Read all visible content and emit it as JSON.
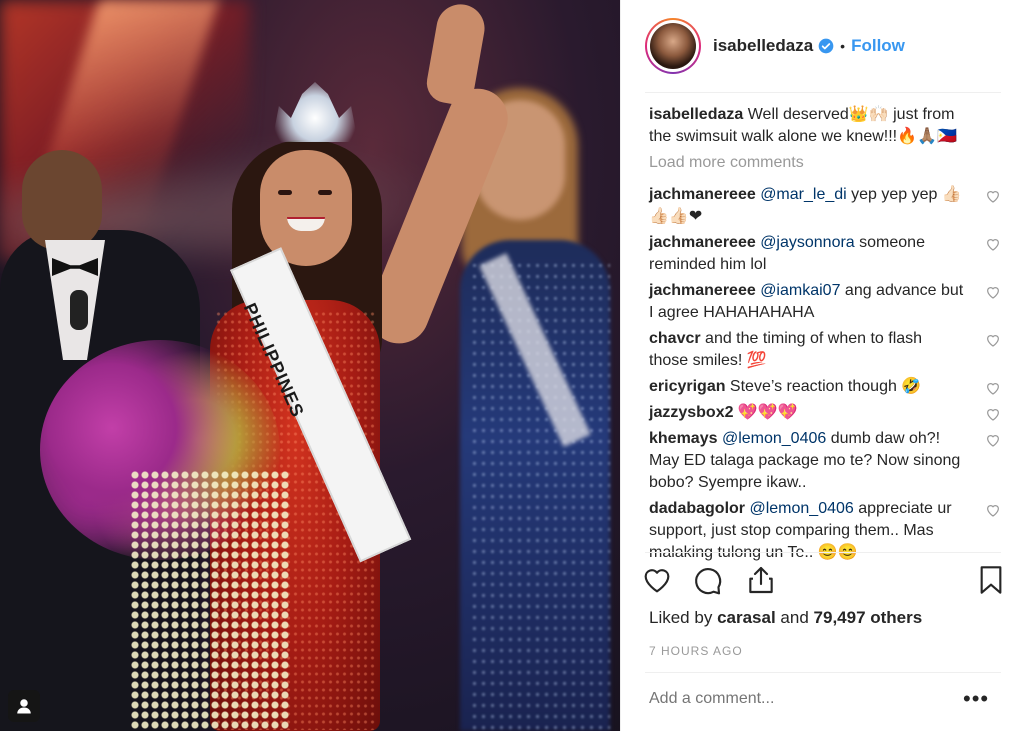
{
  "post": {
    "photo_alt": "Miss Universe winner waving",
    "sash_text": "PHILIPPINES"
  },
  "header": {
    "username": "isabelledaza",
    "dot": "•",
    "follow_label": "Follow"
  },
  "caption": {
    "username": "isabelledaza",
    "text": "Well deserved👑🙌🏻 just from the swimsuit walk alone we knew!!!🔥🙏🏽🇵🇭"
  },
  "load_more_label": "Load more comments",
  "comments": [
    {
      "username": "jachmanereee",
      "mention": "@mar_le_di",
      "text": " yep yep yep 👍🏻👍🏻👍🏻❤"
    },
    {
      "username": "jachmanereee",
      "mention": "@jaysonnora",
      "text": " someone reminded him lol"
    },
    {
      "username": "jachmanereee",
      "mention": "@iamkai07",
      "text": " ang advance but I agree HAHAHAHAHA"
    },
    {
      "username": "chavcr",
      "mention": "",
      "text": " and the timing of when to flash those smiles! 💯"
    },
    {
      "username": "ericyrigan",
      "mention": "",
      "text": " Steve’s reaction though 🤣"
    },
    {
      "username": "jazzysbox2",
      "mention": "",
      "text": " 💖💖💖"
    },
    {
      "username": "khemays",
      "mention": "@lemon_0406",
      "text": " dumb daw oh?! May ED talaga package mo te? Now sinong bobo? Syempre ikaw.."
    },
    {
      "username": "dadabagolor",
      "mention": "@lemon_0406",
      "text": " appreciate ur support, just stop comparing them.. Mas malaking tulong un Te.. 😊😊"
    }
  ],
  "likes": {
    "prefix": "Liked by",
    "user": "carasal",
    "and": "and",
    "count": "79,497 others"
  },
  "timestamp": "7 HOURS AGO",
  "add_comment_placeholder": "Add a comment...",
  "more_label": "•••",
  "colors": {
    "accent": "#3897f0",
    "mention": "#003569",
    "muted": "#999999"
  },
  "icons": [
    "verified-icon",
    "heart-icon",
    "comment-icon",
    "share-icon",
    "bookmark-icon",
    "user-tag-icon",
    "small-heart-icon"
  ]
}
